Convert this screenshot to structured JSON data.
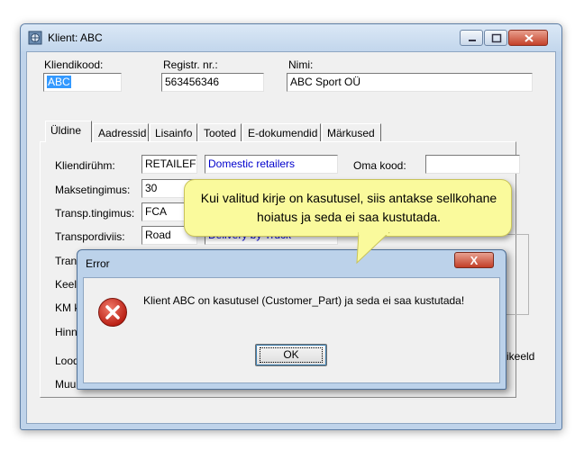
{
  "window": {
    "title": "Klient: ABC"
  },
  "header": {
    "code_label": "Kliendikood:",
    "code_value": "ABC",
    "reg_label": "Registr. nr.:",
    "reg_value": "563456346",
    "name_label": "Nimi:",
    "name_value": "ABC Sport OÜ"
  },
  "tabs": [
    "Üldine",
    "Aadressid",
    "Lisainfo",
    "Tooted",
    "E-dokumendid",
    "Märkused"
  ],
  "general": {
    "group_label": "Kliendirühm:",
    "group_code": "RETAILEF",
    "group_desc": "Domestic retailers",
    "own_code_label": "Oma kood:",
    "payment_label": "Maksetingimus:",
    "payment_code": "30",
    "transport_terms_label": "Transp.tingimus:",
    "transport_terms_code": "FCA",
    "transport_mode_label": "Transpordiviis:",
    "transport_mode_code": "Road",
    "transport_mode_desc": "Delivery by Truck",
    "partial_labels": [
      "Tran",
      "Keel",
      "KM k",
      "Hinn",
      "Lood",
      "Muu"
    ],
    "partial_right_label": "ikeeld"
  },
  "balloon": {
    "text": "Kui valitud kirje on kasutusel, siis antakse sellkohane hoiatus ja seda ei saa kustutada."
  },
  "error_dialog": {
    "title": "Error",
    "message": "Klient ABC on kasutusel (Customer_Part) ja seda ei saa kustutada!",
    "ok_label": "OK",
    "close_glyph": "X"
  },
  "icons": {
    "window": "app-icon",
    "error": "error-x-icon"
  },
  "colors": {
    "balloon": "#fafa9c",
    "error_icon": "#d0261c",
    "selection": "#3399ff",
    "link_text": "#0000cc"
  }
}
